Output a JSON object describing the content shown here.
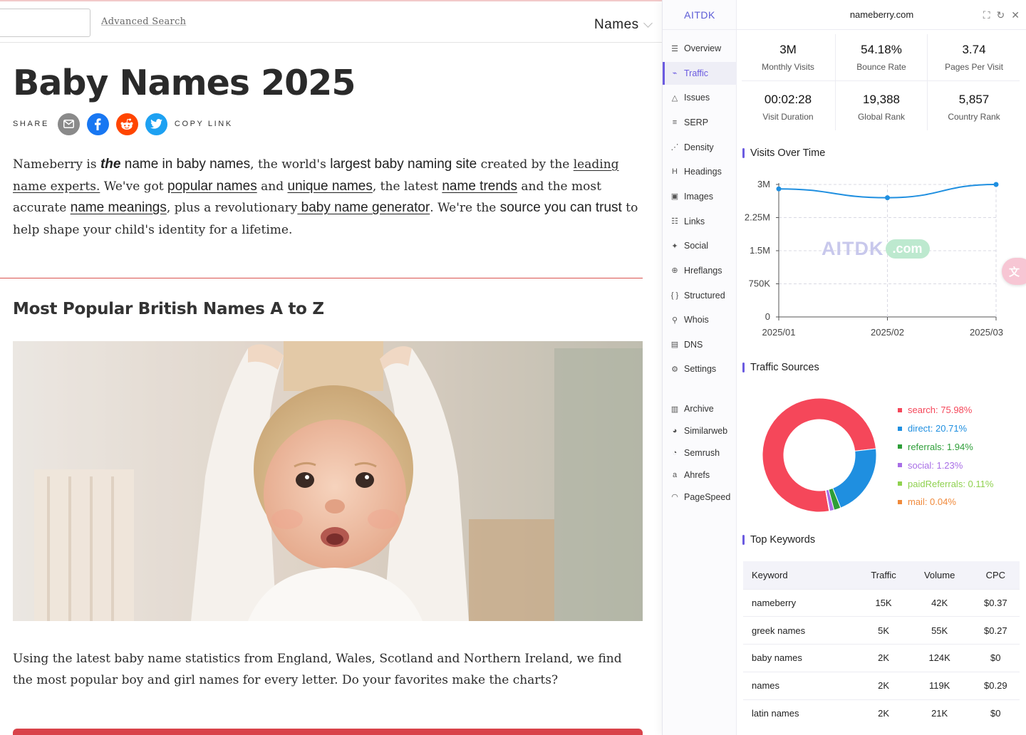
{
  "site": {
    "advanced_search": "Advanced Search",
    "names_menu": "Names",
    "title": "Baby Names 2025",
    "share_label": "SHARE",
    "copy_link": "COPY LINK",
    "intro": {
      "p1": "Nameberry is ",
      "p2": "the",
      "p3": " name in baby names",
      "p4": ", the world's ",
      "p5": "largest baby naming site",
      "p6": " created by the ",
      "p7": "leading name experts.",
      "p8": " We've got ",
      "p9": "popular names",
      "p10": " and ",
      "p11": "unique names",
      "p12": ", the latest ",
      "p13": "name trends",
      "p14": " and the most accurate ",
      "p15": "name meanings",
      "p16": ", plus a revolutionary",
      "p17": " baby name generator",
      "p18": ". We're the ",
      "p19": "source you can trust",
      "p20": " to help shape your child's identity for a lifetime."
    },
    "section_heading": "Most Popular British Names A to Z",
    "body2": "Using the latest baby name statistics from England, Wales, Scotland and Northern Ireland, we find the most popular boy and girl names for every letter. Do your favorites make the charts?"
  },
  "panel": {
    "brand": "AITDK",
    "domain": "nameberry.com",
    "nav": [
      {
        "label": "Overview",
        "icon": "overview-icon",
        "glyph": "☰"
      },
      {
        "label": "Traffic",
        "icon": "traffic-icon",
        "glyph": "⌁",
        "active": true
      },
      {
        "label": "Issues",
        "icon": "warning-icon",
        "glyph": "△"
      },
      {
        "label": "SERP",
        "icon": "serp-icon",
        "glyph": "≡"
      },
      {
        "label": "Density",
        "icon": "density-icon",
        "glyph": "⋰"
      },
      {
        "label": "Headings",
        "icon": "heading-icon",
        "glyph": "H"
      },
      {
        "label": "Images",
        "icon": "image-icon",
        "glyph": "▣"
      },
      {
        "label": "Links",
        "icon": "links-icon",
        "glyph": "☷"
      },
      {
        "label": "Social",
        "icon": "twitter-icon",
        "glyph": "✦"
      },
      {
        "label": "Hreflangs",
        "icon": "globe-icon",
        "glyph": "⊕"
      },
      {
        "label": "Structured",
        "icon": "braces-icon",
        "glyph": "{ }"
      },
      {
        "label": "Whois",
        "icon": "user-search-icon",
        "glyph": "⚲"
      },
      {
        "label": "DNS",
        "icon": "server-icon",
        "glyph": "▤"
      },
      {
        "label": "Settings",
        "icon": "gear-icon",
        "glyph": "⚙"
      }
    ],
    "tools": [
      {
        "label": "Archive",
        "icon": "archive-icon",
        "glyph": "▥"
      },
      {
        "label": "Similarweb",
        "icon": "similarweb-icon",
        "glyph": "◕"
      },
      {
        "label": "Semrush",
        "icon": "semrush-icon",
        "glyph": "◔"
      },
      {
        "label": "Ahrefs",
        "icon": "ahrefs-icon",
        "glyph": "a"
      },
      {
        "label": "PageSpeed",
        "icon": "pagespeed-icon",
        "glyph": "◠"
      }
    ],
    "stats": [
      {
        "value": "3M",
        "label": "Monthly Visits"
      },
      {
        "value": "54.18%",
        "label": "Bounce Rate"
      },
      {
        "value": "3.74",
        "label": "Pages Per Visit"
      },
      {
        "value": "00:02:28",
        "label": "Visit Duration"
      },
      {
        "value": "19,388",
        "label": "Global Rank"
      },
      {
        "value": "5,857",
        "label": "Country Rank"
      }
    ],
    "visits_title": "Visits Over Time",
    "sources_title": "Traffic Sources",
    "keywords_title": "Top Keywords",
    "watermark": {
      "a": "AITDK",
      "b": ".com"
    },
    "keywords": {
      "headers": [
        "Keyword",
        "Traffic",
        "Volume",
        "CPC"
      ],
      "rows": [
        [
          "nameberry",
          "15K",
          "42K",
          "$0.37"
        ],
        [
          "greek names",
          "5K",
          "55K",
          "$0.27"
        ],
        [
          "baby names",
          "2K",
          "124K",
          "$0"
        ],
        [
          "names",
          "2K",
          "119K",
          "$0.29"
        ],
        [
          "latin names",
          "2K",
          "21K",
          "$0"
        ]
      ]
    }
  },
  "colors": {
    "accent": "#6b5be0",
    "line": "#1f8fe0",
    "search": "#f5475a",
    "direct": "#1f8fe0",
    "referrals": "#2e9e38",
    "social": "#a86ee6",
    "paidReferrals": "#8fd14f",
    "mail": "#f08a3c",
    "site_red": "#d9434a"
  },
  "chart_data": [
    {
      "type": "line",
      "title": "Visits Over Time",
      "x": [
        "2025/01",
        "2025/02",
        "2025/03"
      ],
      "series": [
        {
          "values": [
            2900000,
            2700000,
            3000000
          ]
        }
      ],
      "yticks": [
        "0",
        "750K",
        "1.5M",
        "2.25M",
        "3M"
      ],
      "ylim": [
        0,
        3000000
      ],
      "grid": true
    },
    {
      "type": "pie",
      "title": "Traffic Sources",
      "donut": true,
      "legend": "right",
      "slices": [
        {
          "name": "search",
          "label": "search: 75.98%",
          "value": 75.98
        },
        {
          "name": "direct",
          "label": "direct: 20.71%",
          "value": 20.71
        },
        {
          "name": "referrals",
          "label": "referrals: 1.94%",
          "value": 1.94
        },
        {
          "name": "social",
          "label": "social: 1.23%",
          "value": 1.23
        },
        {
          "name": "paidReferrals",
          "label": "paidReferrals: 0.11%",
          "value": 0.11
        },
        {
          "name": "mail",
          "label": "mail: 0.04%",
          "value": 0.04
        }
      ]
    }
  ]
}
